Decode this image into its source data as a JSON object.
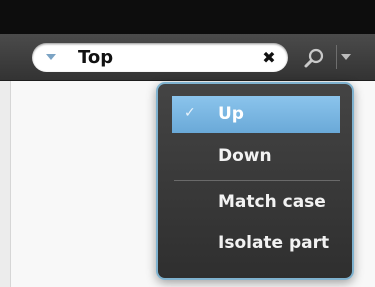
{
  "search": {
    "value": "Top",
    "clear_icon": "clear-x-icon",
    "scope_icon": "chevron-down-icon",
    "search_icon": "magnifier-icon",
    "options_icon": "dropdown-arrow-icon"
  },
  "menu": {
    "items": [
      {
        "label": "Up",
        "checked": true
      },
      {
        "label": "Down",
        "checked": false
      },
      {
        "label": "Match case",
        "checked": false
      },
      {
        "label": "Isolate part",
        "checked": false
      }
    ],
    "check_glyph": "✓"
  },
  "colors": {
    "highlight": "#7ab7e2",
    "menu_border": "#7fb2cf",
    "menu_bg": "#3a3a3a",
    "toolbar_bg": "#404040"
  }
}
